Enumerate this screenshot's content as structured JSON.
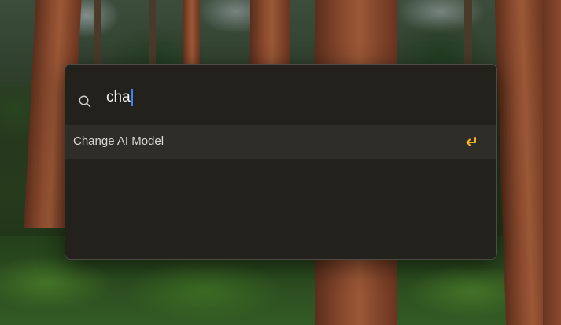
{
  "launcher": {
    "search": {
      "value": "cha",
      "icon": "search-icon"
    },
    "results": [
      {
        "label": "Change AI Model",
        "icon": "enter-key-icon"
      }
    ]
  },
  "colors": {
    "panel_background": "#22211c",
    "selected_row": "#2e2d28",
    "caret": "#3b82f6",
    "enter_icon": "#f0b429"
  }
}
